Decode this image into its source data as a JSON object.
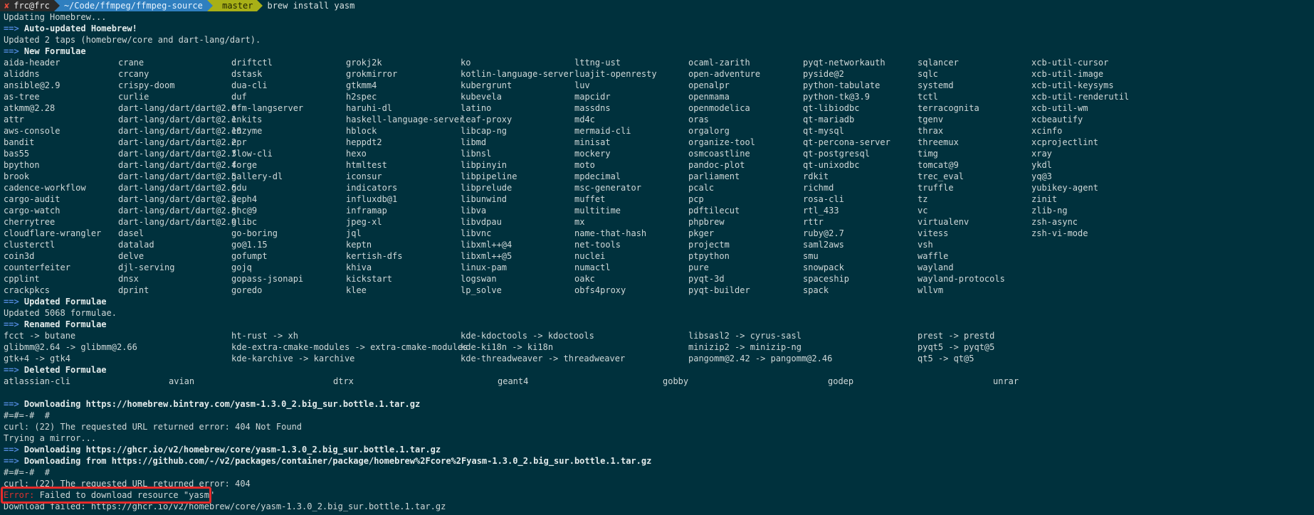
{
  "prompt": {
    "status_icon": "✘",
    "user": "frc@frc",
    "path": "~/Code/ffmpeg/ffmpeg-source",
    "branch_icon": "",
    "branch": "master",
    "command": "brew install yasm"
  },
  "lines": {
    "updating": "Updating Homebrew...",
    "auto_updated_hdr": "Auto-updated Homebrew!",
    "updated_taps": "Updated 2 taps (homebrew/core and dart-lang/dart).",
    "new_formulae_hdr": "New Formulae",
    "updated_formulae_hdr": "Updated Formulae",
    "updated_count": "Updated 5068 formulae.",
    "renamed_formulae_hdr": "Renamed Formulae",
    "deleted_formulae_hdr": "Deleted Formulae",
    "dl1": "Downloading https://homebrew.bintray.com/yasm-1.3.0_2.big_sur.bottle.1.tar.gz",
    "progress1": "#=#=-#  #",
    "curl_404_1": "curl: (22) The requested URL returned error: 404 Not Found",
    "trying_mirror": "Trying a mirror...",
    "dl2": "Downloading https://ghcr.io/v2/homebrew/core/yasm-1.3.0_2.big_sur.bottle.1.tar.gz",
    "dl3": "Downloading from https://github.com/-/v2/packages/container/package/homebrew%2Fcore%2Fyasm-1.3.0_2.big_sur.bottle.1.tar.gz",
    "progress2": "#=#=-#  #",
    "curl_404_2": "curl: (22) The requested URL returned error: 404",
    "error_label": "Error:",
    "error_msg": " Failed to download resource \"yasm\"",
    "download_failed": "Download failed: https://ghcr.io/v2/homebrew/core/yasm-1.3.0_2.big_sur.bottle.1.tar.gz",
    "arrow": "==>"
  },
  "new_formulae": [
    [
      "aida-header",
      "crane",
      "driftctl",
      "grokj2k",
      "ko",
      "lttng-ust",
      "ocaml-zarith",
      "pyqt-networkauth",
      "sqlancer",
      "xcb-util-cursor"
    ],
    [
      "aliddns",
      "crcany",
      "dstask",
      "grokmirror",
      "kotlin-language-server",
      "luajit-openresty",
      "open-adventure",
      "pyside@2",
      "sqlc",
      "xcb-util-image"
    ],
    [
      "ansible@2.9",
      "crispy-doom",
      "dua-cli",
      "gtkmm4",
      "kubergrunt",
      "luv",
      "openalpr",
      "python-tabulate",
      "systemd",
      "xcb-util-keysyms"
    ],
    [
      "as-tree",
      "curlie",
      "duf",
      "h2spec",
      "kubevela",
      "mapcidr",
      "openmama",
      "python-tk@3.9",
      "tctl",
      "xcb-util-renderutil"
    ],
    [
      "atkmm@2.28",
      "dart-lang/dart/dart@2.0",
      "efm-langserver",
      "haruhi-dl",
      "latino",
      "massdns",
      "openmodelica",
      "qt-libiodbc",
      "terracognita",
      "xcb-util-wm"
    ],
    [
      "attr",
      "dart-lang/dart/dart@2.1",
      "enkits",
      "haskell-language-server",
      "leaf-proxy",
      "md4c",
      "oras",
      "qt-mariadb",
      "tgenv",
      "xcbeautify"
    ],
    [
      "aws-console",
      "dart-lang/dart/dart@2.10",
      "enzyme",
      "hblock",
      "libcap-ng",
      "mermaid-cli",
      "orgalorg",
      "qt-mysql",
      "thrax",
      "xcinfo"
    ],
    [
      "bandit",
      "dart-lang/dart/dart@2.2",
      "epr",
      "heppdt2",
      "libmd",
      "minisat",
      "organize-tool",
      "qt-percona-server",
      "threemux",
      "xcprojectlint"
    ],
    [
      "bas55",
      "dart-lang/dart/dart@2.3",
      "flow-cli",
      "hexo",
      "libnsl",
      "mockery",
      "osmcoastline",
      "qt-postgresql",
      "timg",
      "xray"
    ],
    [
      "bpython",
      "dart-lang/dart/dart@2.4",
      "forge",
      "htmltest",
      "libpinyin",
      "moto",
      "pandoc-plot",
      "qt-unixodbc",
      "tomcat@9",
      "ykdl"
    ],
    [
      "brook",
      "dart-lang/dart/dart@2.5",
      "gallery-dl",
      "iconsur",
      "libpipeline",
      "mpdecimal",
      "parliament",
      "rdkit",
      "trec_eval",
      "yq@3"
    ],
    [
      "cadence-workflow",
      "dart-lang/dart/dart@2.6",
      "gdu",
      "indicators",
      "libprelude",
      "msc-generator",
      "pcalc",
      "richmd",
      "truffle",
      "yubikey-agent"
    ],
    [
      "cargo-audit",
      "dart-lang/dart/dart@2.7",
      "geph4",
      "influxdb@1",
      "libunwind",
      "muffet",
      "pcp",
      "rosa-cli",
      "tz",
      "zinit"
    ],
    [
      "cargo-watch",
      "dart-lang/dart/dart@2.8",
      "ghc@9",
      "inframap",
      "libva",
      "multitime",
      "pdftilecut",
      "rtl_433",
      "vc",
      "zlib-ng"
    ],
    [
      "cherrytree",
      "dart-lang/dart/dart@2.9",
      "glibc",
      "jpeg-xl",
      "libvdpau",
      "mx",
      "phpbrew",
      "rttr",
      "virtualenv",
      "zsh-async"
    ],
    [
      "cloudflare-wrangler",
      "dasel",
      "go-boring",
      "jql",
      "libvnc",
      "name-that-hash",
      "pkger",
      "ruby@2.7",
      "vitess",
      "zsh-vi-mode"
    ],
    [
      "clusterctl",
      "datalad",
      "go@1.15",
      "keptn",
      "libxml++@4",
      "net-tools",
      "projectm",
      "saml2aws",
      "vsh",
      ""
    ],
    [
      "coin3d",
      "delve",
      "gofumpt",
      "kertish-dfs",
      "libxml++@5",
      "nuclei",
      "ptpython",
      "smu",
      "waffle",
      ""
    ],
    [
      "counterfeiter",
      "djl-serving",
      "gojq",
      "khiva",
      "linux-pam",
      "numactl",
      "pure",
      "snowpack",
      "wayland",
      ""
    ],
    [
      "cpplint",
      "dnsx",
      "gopass-jsonapi",
      "kickstart",
      "logswan",
      "oakc",
      "pyqt-3d",
      "spaceship",
      "wayland-protocols",
      ""
    ],
    [
      "crackpkcs",
      "dprint",
      "goredo",
      "klee",
      "lp_solve",
      "obfs4proxy",
      "pyqt-builder",
      "spack",
      "wllvm",
      ""
    ]
  ],
  "renamed_formulae": [
    [
      "fcct -> butane",
      "ht-rust -> xh",
      "kde-kdoctools -> kdoctools",
      "libsasl2 -> cyrus-sasl",
      "prest -> prestd"
    ],
    [
      "glibmm@2.64 -> glibmm@2.66",
      "kde-extra-cmake-modules -> extra-cmake-modules",
      "kde-ki18n -> ki18n",
      "minizip2 -> minizip-ng",
      "pyqt5 -> pyqt@5"
    ],
    [
      "gtk+4 -> gtk4",
      "kde-karchive -> karchive",
      "kde-threadweaver -> threadweaver",
      "pangomm@2.42 -> pangomm@2.46",
      "qt5 -> qt@5"
    ]
  ],
  "deleted_formulae": [
    "atlassian-cli",
    "avian",
    "dtrx",
    "geant4",
    "gobby",
    "godep",
    "unrar"
  ],
  "colors": {
    "background": "#00313d",
    "text": "#cfd8d8",
    "arrow": "#4f86d7",
    "error": "#dc322f",
    "highlight_box": "#e62a2a"
  }
}
